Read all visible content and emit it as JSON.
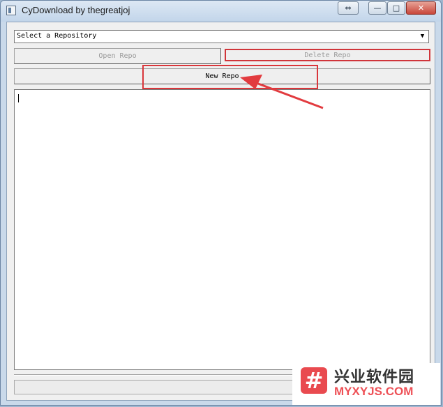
{
  "window": {
    "title": "CyDownload by thegreatjoj",
    "controls": {
      "restore": "⇔",
      "minimize": "—",
      "maximize": "□",
      "close": "✕"
    }
  },
  "repository_select": {
    "selected": "Select a Repository",
    "arrow": "▼"
  },
  "buttons": {
    "open_repo": "Open Repo",
    "delete_repo": "Delete Repo",
    "new_repo": "New Repo"
  },
  "annotation": {
    "color": "#d9363b"
  },
  "watermark": {
    "title": "兴业软件园",
    "url": "MYXYJS.COM",
    "logo_glyph": "#"
  },
  "icons": [
    "app-icon",
    "restore-icon",
    "minimize-icon",
    "maximize-icon",
    "close-icon",
    "dropdown-arrow-icon",
    "annotation-arrow-icon",
    "watermark-logo-icon"
  ]
}
